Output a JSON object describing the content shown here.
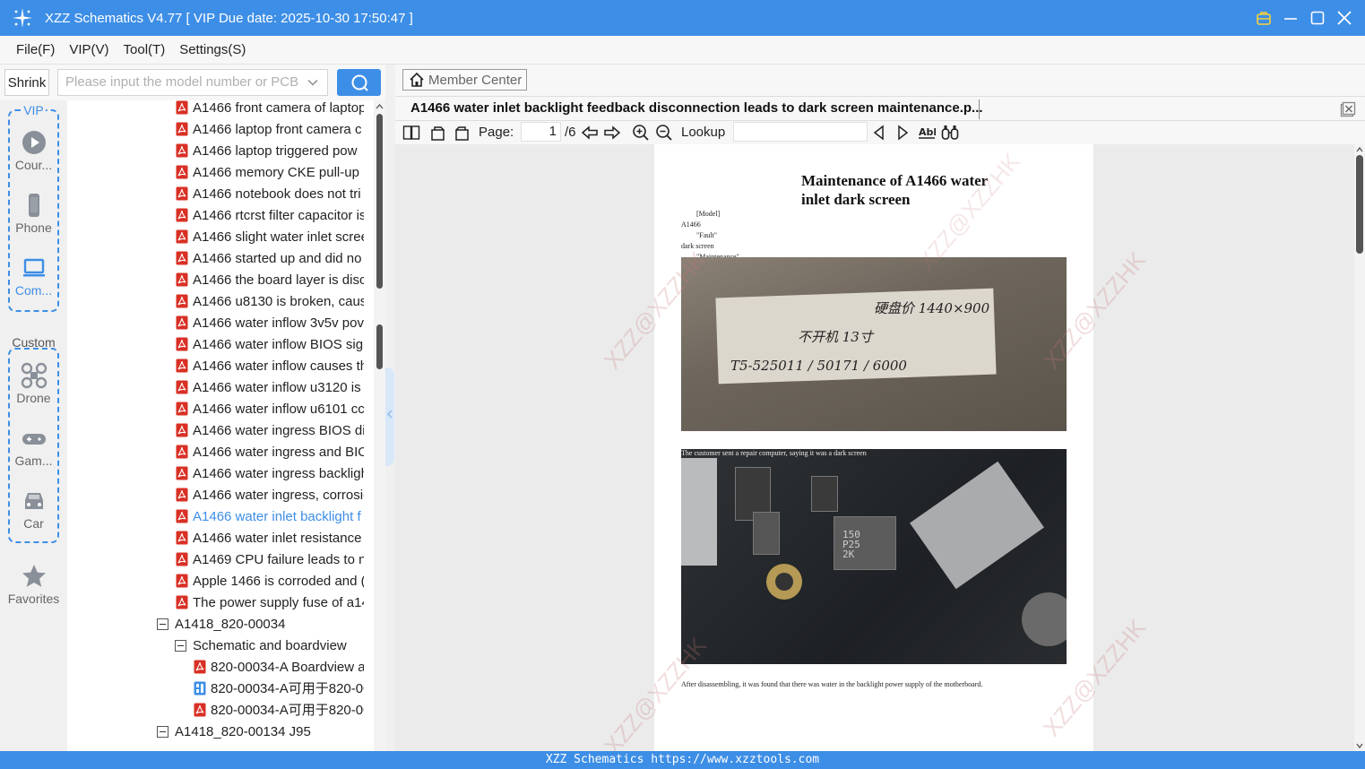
{
  "window": {
    "title": "XZZ Schematics V4.77 [ VIP Due date: 2025-10-30 17:50:47 ]"
  },
  "menu": [
    "File(F)",
    "VIP(V)",
    "Tool(T)",
    "Settings(S)"
  ],
  "search": {
    "shrink_label": "Shrink",
    "placeholder": "Please input the model number or PCB"
  },
  "sidebar": {
    "vip_label": "VIP",
    "custom_label": "Custom",
    "items": [
      {
        "label": "Cour...",
        "icon": "play-icon"
      },
      {
        "label": "Phone",
        "icon": "phone-icon"
      },
      {
        "label": "Com...",
        "icon": "laptop-icon"
      },
      {
        "label": "Drone",
        "icon": "drone-icon"
      },
      {
        "label": "Gam...",
        "icon": "gamepad-icon"
      },
      {
        "label": "Car",
        "icon": "car-icon"
      },
      {
        "label": "Favorites",
        "icon": "star-icon"
      }
    ]
  },
  "tree": {
    "items": [
      "A1466 front camera of laptop",
      "A1466 laptop front camera c",
      "A1466 laptop triggered pow",
      "A1466 memory CKE pull-up r",
      "A1466 notebook does not tri",
      "A1466 rtcrst filter capacitor is",
      "A1466 slight water inlet scree",
      "A1466 started up and did no",
      "A1466 the board layer is disc",
      "A1466 u8130 is broken, caus",
      "A1466 water inflow 3v5v pov",
      "A1466 water inflow BIOS sign",
      "A1466 water inflow causes th",
      "A1466 water inflow u3120 is",
      "A1466 water inflow u6101 cc",
      "A1466 water ingress BIOS dis",
      "A1466 water ingress and BIO",
      "A1466 water ingress backligh",
      "A1466 water ingress, corrosic",
      "A1466 water inlet backlight f",
      "A1466 water inlet resistance",
      "A1469 CPU failure leads to n",
      "Apple 1466 is corroded and (",
      "The power supply fuse of a14"
    ],
    "selected_index": 19,
    "group1": "A1418_820-00034",
    "sub1": "Schematic and boardview",
    "files": [
      "820-00034-A Boardview a",
      "820-00034-A可用于820-00",
      "820-00034-A可用于820-00"
    ],
    "group2": "A1418_820-00134 J95"
  },
  "right": {
    "member_center": "Member Center",
    "tab_title": "A1466 water inlet backlight feedback disconnection leads to dark screen maintenance.p...",
    "page_label": "Page:",
    "page_value": "1",
    "page_total": "/6",
    "lookup_label": "Lookup"
  },
  "document": {
    "title_line1": "Maintenance of A1466 water",
    "title_line2": "inlet dark screen",
    "meta": [
      "[Model]",
      "A1466",
      "\"Fault\"",
      "dark screen",
      "\"Maintenance\""
    ],
    "photo1_text": [
      "硬盘价 1440×900",
      "不开机 13寸",
      "T5-525011 / 50171 / 6000"
    ],
    "photo2_caption": "The customer sent a repair computer, saying it was a dark screen",
    "caption": "After disassembling, it was found that there was water in the backlight power supply of the motherboard.",
    "chip_label": "150 P25 2K",
    "watermarks": [
      "XZZ@XZZHK",
      "XZZ@XZZHK",
      "XZZ@XZZHK",
      "XZZ@XZZHK",
      "XZZ@XZZHK"
    ]
  },
  "footer": {
    "text": "XZZ Schematics https://www.xzztools.com"
  },
  "colors": {
    "accent": "#3d8ee6",
    "pdf_red": "#d93025",
    "selected_text": "#3d8ee6"
  }
}
